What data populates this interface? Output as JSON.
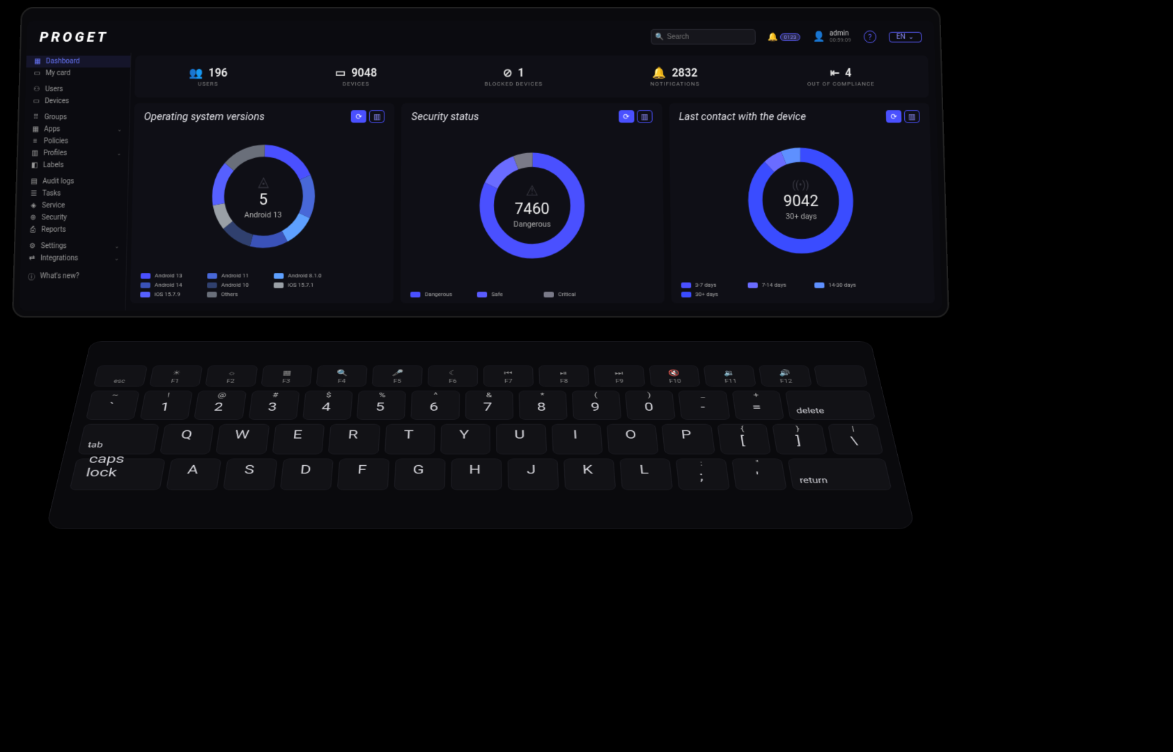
{
  "brand": "PROGET",
  "search": {
    "placeholder": "Search"
  },
  "header": {
    "bell_badge": "0123",
    "user_name": "admin",
    "user_time": "00:59:09",
    "lang": "EN"
  },
  "sidebar": [
    {
      "icon": "▦",
      "label": "Dashboard",
      "active": true
    },
    {
      "icon": "▭",
      "label": "My card"
    },
    {
      "sep": true
    },
    {
      "icon": "⚇",
      "label": "Users"
    },
    {
      "icon": "▭",
      "label": "Devices"
    },
    {
      "sep": true
    },
    {
      "icon": "⠿",
      "label": "Groups"
    },
    {
      "icon": "▦",
      "label": "Apps",
      "chev": true
    },
    {
      "icon": "≡",
      "label": "Policies"
    },
    {
      "icon": "▥",
      "label": "Profiles",
      "chev": true
    },
    {
      "icon": "◧",
      "label": "Labels"
    },
    {
      "sep": true
    },
    {
      "icon": "▤",
      "label": "Audit logs"
    },
    {
      "icon": "☰",
      "label": "Tasks"
    },
    {
      "icon": "◈",
      "label": "Service"
    },
    {
      "icon": "⊕",
      "label": "Security"
    },
    {
      "icon": "⎙",
      "label": "Reports"
    },
    {
      "sep": true
    },
    {
      "icon": "⚙",
      "label": "Settings",
      "chev": true
    },
    {
      "icon": "⇄",
      "label": "Integrations",
      "chev": true
    },
    {
      "sep": true
    },
    {
      "icon": "ⓘ",
      "label": "What's new?"
    }
  ],
  "stats": [
    {
      "icon": "👥",
      "value": "196",
      "label": "USERS"
    },
    {
      "icon": "▭",
      "value": "9048",
      "label": "DEVICES"
    },
    {
      "icon": "⊘",
      "value": "1",
      "label": "BLOCKED DEVICES"
    },
    {
      "icon": "🔔",
      "value": "2832",
      "label": "NOTIFICATIONS"
    },
    {
      "icon": "⇤",
      "value": "4",
      "label": "OUT OF COMPLIANCE"
    }
  ],
  "cards": {
    "os": {
      "title": "Operating system versions",
      "center_icon": "◬",
      "center_big": "5",
      "center_sub": "Android 13",
      "legend": [
        {
          "c": "#4a50ff",
          "t": "Android 13"
        },
        {
          "c": "#4868d8",
          "t": "Android 11"
        },
        {
          "c": "#5ea0ff",
          "t": "Android 8.1.0"
        },
        {
          "c": "#3a52b8",
          "t": "Android 14"
        },
        {
          "c": "#30406e",
          "t": "Android 10"
        },
        {
          "c": "#9aa0a6",
          "t": "iOS 15.7.1"
        },
        {
          "c": "#5660ff",
          "t": "iOS 15.7.9"
        },
        {
          "c": "#6a6f7a",
          "t": "Others"
        }
      ]
    },
    "sec": {
      "title": "Security status",
      "center_icon": "⚠",
      "center_big": "7460",
      "center_sub": "Dangerous",
      "legend": [
        {
          "c": "#4a50ff",
          "t": "Dangerous"
        },
        {
          "c": "#5a5cff",
          "t": "Safe"
        },
        {
          "c": "#7a7a88",
          "t": "Critical"
        }
      ]
    },
    "last": {
      "title": "Last contact with the device",
      "center_icon": "((•))",
      "center_big": "9042",
      "center_sub": "30+ days",
      "legend": [
        {
          "c": "#4a50ff",
          "t": "3-7 days"
        },
        {
          "c": "#6a6cff",
          "t": "7-14 days"
        },
        {
          "c": "#5e90ff",
          "t": "14-30 days"
        },
        {
          "c": "#3a4cff",
          "t": "30+ days"
        }
      ]
    }
  },
  "chart_data": [
    {
      "type": "pie",
      "title": "Operating system versions",
      "series": [
        {
          "name": "Android 13",
          "value": 5,
          "hint": "center label = selected slice count"
        }
      ],
      "note": "Multi-slice donut; individual slice values not labeled numerically on screen. Center shows '5 / Android 13'. Legend lists 8 categories."
    },
    {
      "type": "pie",
      "title": "Security status",
      "series": [
        {
          "name": "Dangerous",
          "value": 7460
        },
        {
          "name": "Safe",
          "value": null
        },
        {
          "name": "Critical",
          "value": null
        }
      ],
      "note": "Center shows 7460 Dangerous; other slice values not printed."
    },
    {
      "type": "pie",
      "title": "Last contact with the device",
      "series": [
        {
          "name": "30+ days",
          "value": 9042
        },
        {
          "name": "3-7 days",
          "value": null
        },
        {
          "name": "7-14 days",
          "value": null
        },
        {
          "name": "14-30 days",
          "value": null
        }
      ],
      "note": "Center shows 9042 / 30+ days; other slice values not printed."
    }
  ],
  "keyboard": {
    "fn": [
      {
        "l": "esc"
      },
      {
        "i": "☀",
        "l": "F1"
      },
      {
        "i": "☼",
        "l": "F2"
      },
      {
        "i": "▦",
        "l": "F3"
      },
      {
        "i": "🔍",
        "l": "F4"
      },
      {
        "i": "🎤",
        "l": "F5"
      },
      {
        "i": "☾",
        "l": "F6"
      },
      {
        "i": "⏮",
        "l": "F7"
      },
      {
        "i": "⏯",
        "l": "F8"
      },
      {
        "i": "⏭",
        "l": "F9"
      },
      {
        "i": "🔇",
        "l": "F10"
      },
      {
        "i": "🔉",
        "l": "F11"
      },
      {
        "i": "🔊",
        "l": "F12"
      },
      {
        "l": ""
      }
    ],
    "r1": [
      {
        "s": "~",
        "m": "`"
      },
      {
        "s": "!",
        "m": "1"
      },
      {
        "s": "@",
        "m": "2"
      },
      {
        "s": "#",
        "m": "3"
      },
      {
        "s": "$",
        "m": "4"
      },
      {
        "s": "%",
        "m": "5"
      },
      {
        "s": "^",
        "m": "6"
      },
      {
        "s": "&",
        "m": "7"
      },
      {
        "s": "*",
        "m": "8"
      },
      {
        "s": "(",
        "m": "9"
      },
      {
        "s": ")",
        "m": "0"
      },
      {
        "s": "_",
        "m": "-"
      },
      {
        "s": "+",
        "m": "="
      },
      {
        "m": "delete",
        "wide": "wide18",
        "low": true
      }
    ],
    "r2": [
      {
        "m": "tab",
        "wide": "wide15",
        "low": true
      },
      {
        "m": "Q"
      },
      {
        "m": "W"
      },
      {
        "m": "E"
      },
      {
        "m": "R"
      },
      {
        "m": "T"
      },
      {
        "m": "Y"
      },
      {
        "m": "U"
      },
      {
        "m": "I"
      },
      {
        "m": "O"
      },
      {
        "m": "P"
      },
      {
        "s": "{",
        "m": "["
      },
      {
        "s": "}",
        "m": "]"
      },
      {
        "s": "|",
        "m": "\\"
      }
    ],
    "r3": [
      {
        "m": "caps lock",
        "wide": "wide18",
        "low": true,
        "s": "•"
      },
      {
        "m": "A"
      },
      {
        "m": "S"
      },
      {
        "m": "D"
      },
      {
        "m": "F"
      },
      {
        "m": "G"
      },
      {
        "m": "H"
      },
      {
        "m": "J"
      },
      {
        "m": "K"
      },
      {
        "m": "L"
      },
      {
        "s": ":",
        "m": ";"
      },
      {
        "s": "\"",
        "m": "'"
      },
      {
        "m": "return",
        "wide": "wide20",
        "low": true
      }
    ]
  }
}
